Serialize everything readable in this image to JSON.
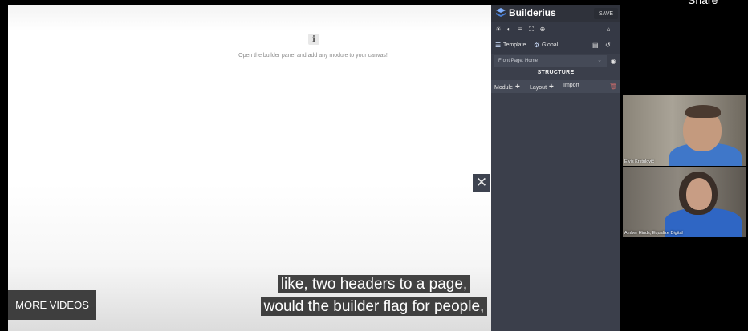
{
  "canvas": {
    "info_icon": "i",
    "empty_message": "Open the builder panel and add any module to your canvas!"
  },
  "panel": {
    "brand": "Builderius",
    "save_label": "SAVE",
    "tabs": [
      {
        "icon": "template-icon",
        "label": "Template"
      },
      {
        "icon": "gear-icon",
        "label": "Global"
      }
    ],
    "page_select": "Front Page: Home",
    "structure_title": "STRUCTURE",
    "structure_actions": [
      {
        "label": "Module"
      },
      {
        "label": "Layout"
      },
      {
        "label": "Import"
      }
    ]
  },
  "participants": [
    {
      "name": "Elvis Krstulović"
    },
    {
      "name": "Amber Hinds, Equalize Digital"
    }
  ],
  "more_videos": "MORE VIDEOS",
  "captions": [
    "like, two headers to a page,",
    "would the builder flag for people,"
  ],
  "top_right": "Share",
  "colors": {
    "panel_bg": "#3b3f4b",
    "panel_header": "#2f323b",
    "accent_blue": "#5a8dd8",
    "caption_bg": "#080808"
  }
}
